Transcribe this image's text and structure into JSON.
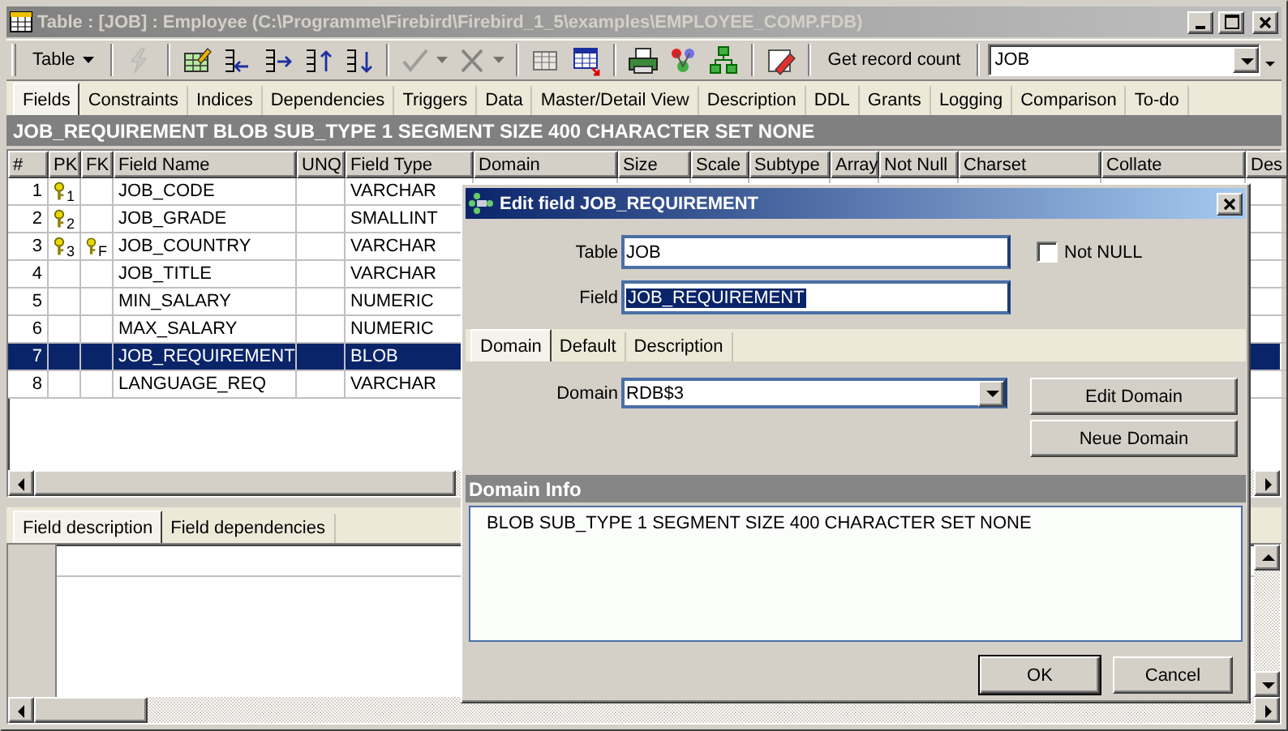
{
  "window": {
    "title": "Table : [JOB] : Employee (C:\\Programme\\Firebird\\Firebird_1_5\\examples\\EMPLOYEE_COMP.FDB)"
  },
  "toolbar": {
    "menu_button": "Table",
    "record_count_button": "Get record count",
    "table_combo": "JOB",
    "tool_groups": [
      [
        {
          "kind": "lightning",
          "disabled": true
        }
      ],
      [
        {
          "kind": "grid-edit",
          "disabled": false
        },
        {
          "kind": "insert",
          "disabled": false
        },
        {
          "kind": "append",
          "disabled": false
        },
        {
          "kind": "up",
          "disabled": false
        },
        {
          "kind": "down",
          "disabled": false
        }
      ],
      [
        {
          "kind": "check",
          "disabled": true
        },
        {
          "kind": "cross",
          "disabled": true
        }
      ],
      [
        {
          "kind": "grid",
          "disabled": true
        },
        {
          "kind": "grid-export",
          "disabled": false
        }
      ],
      [
        {
          "kind": "printer",
          "disabled": false
        },
        {
          "kind": "tree-color",
          "disabled": false
        },
        {
          "kind": "tree",
          "disabled": false
        }
      ],
      [
        {
          "kind": "eraser",
          "disabled": false
        }
      ]
    ]
  },
  "tabs": [
    {
      "label": "Fields",
      "selected": true
    },
    {
      "label": "Constraints",
      "selected": false
    },
    {
      "label": "Indices",
      "selected": false
    },
    {
      "label": "Dependencies",
      "selected": false
    },
    {
      "label": "Triggers",
      "selected": false
    },
    {
      "label": "Data",
      "selected": false
    },
    {
      "label": "Master/Detail View",
      "selected": false
    },
    {
      "label": "Description",
      "selected": false
    },
    {
      "label": "DDL",
      "selected": false
    },
    {
      "label": "Grants",
      "selected": false
    },
    {
      "label": "Logging",
      "selected": false
    },
    {
      "label": "Comparison",
      "selected": false
    },
    {
      "label": "To-do",
      "selected": false
    }
  ],
  "header_bar": "JOB_REQUIREMENT BLOB SUB_TYPE 1 SEGMENT SIZE 400 CHARACTER SET NONE",
  "grid": {
    "columns": [
      "#",
      "PK",
      "FK",
      "Field Name",
      "UNQ",
      "Field Type",
      "Domain",
      "Size",
      "Scale",
      "Subtype",
      "Array",
      "Not Null",
      "Charset",
      "Collate",
      "Des"
    ],
    "rows": [
      {
        "number": "1",
        "pk": "1",
        "name": "JOB_CODE",
        "type": "VARCHAR",
        "selected": false
      },
      {
        "number": "2",
        "pk": "2",
        "name": "JOB_GRADE",
        "type": "SMALLINT",
        "selected": false
      },
      {
        "number": "3",
        "pk": "3",
        "fk": "F",
        "name": "JOB_COUNTRY",
        "type": "VARCHAR",
        "selected": false
      },
      {
        "number": "4",
        "name": "JOB_TITLE",
        "type": "VARCHAR",
        "selected": false
      },
      {
        "number": "5",
        "name": "MIN_SALARY",
        "type": "NUMERIC",
        "selected": false
      },
      {
        "number": "6",
        "name": "MAX_SALARY",
        "type": "NUMERIC",
        "selected": false
      },
      {
        "number": "7",
        "name": "JOB_REQUIREMENT",
        "type": "BLOB",
        "selected": true
      },
      {
        "number": "8",
        "name": "LANGUAGE_REQ",
        "type": "VARCHAR",
        "selected": false
      }
    ]
  },
  "bottom_tabs": [
    {
      "label": "Field description",
      "selected": true
    },
    {
      "label": "Field dependencies",
      "selected": false
    }
  ],
  "dialog": {
    "title": "Edit field JOB_REQUIREMENT",
    "table_label": "Table",
    "table_value": "JOB",
    "field_label": "Field",
    "field_value": "JOB_REQUIREMENT",
    "not_null": {
      "label": "Not NULL",
      "checked": false
    },
    "tabs": [
      {
        "label": "Domain",
        "selected": true
      },
      {
        "label": "Default",
        "selected": false
      },
      {
        "label": "Description",
        "selected": false
      }
    ],
    "domain_label": "Domain",
    "domain_value": "RDB$3",
    "side_buttons": [
      "Edit Domain",
      "Neue Domain"
    ],
    "info_title": "Domain Info",
    "info_text": "BLOB SUB_TYPE 1 SEGMENT SIZE 400 CHARACTER SET NONE",
    "buttons": [
      {
        "label": "OK",
        "default": true
      },
      {
        "label": "Cancel",
        "default": false
      }
    ]
  }
}
